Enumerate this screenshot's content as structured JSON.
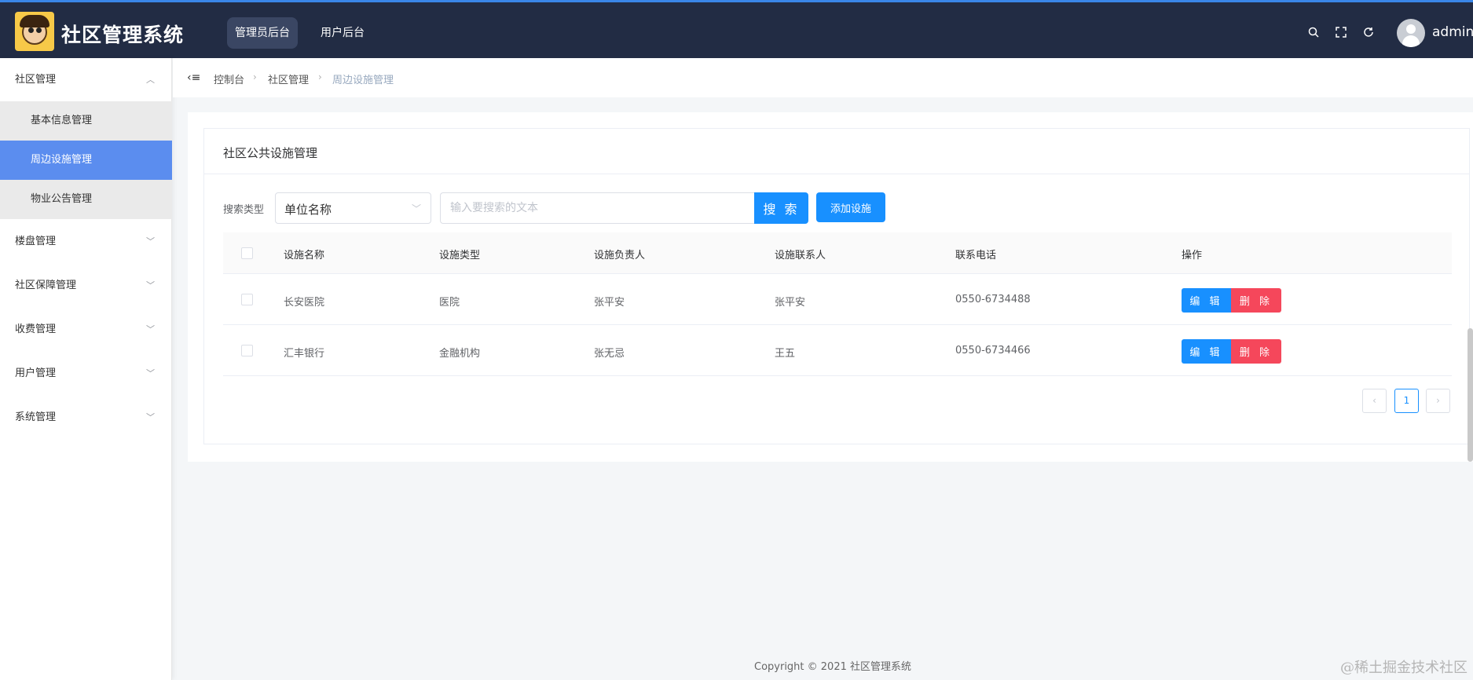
{
  "header": {
    "app_title": "社区管理系统",
    "tabs": [
      {
        "label": "管理员后台",
        "active": true
      },
      {
        "label": "用户后台",
        "active": false
      }
    ],
    "icons": [
      "search-icon",
      "fullscreen-icon",
      "refresh-icon"
    ],
    "username": "admin",
    "background_color": "#222c44"
  },
  "sidebar": {
    "groups": [
      {
        "label": "社区管理",
        "expanded": true,
        "children": [
          {
            "label": "基本信息管理",
            "active": false
          },
          {
            "label": "周边设施管理",
            "active": true
          },
          {
            "label": "物业公告管理",
            "active": false
          }
        ]
      },
      {
        "label": "楼盘管理",
        "expanded": false
      },
      {
        "label": "社区保障管理",
        "expanded": false
      },
      {
        "label": "收费管理",
        "expanded": false
      },
      {
        "label": "用户管理",
        "expanded": false
      },
      {
        "label": "系统管理",
        "expanded": false
      }
    ],
    "active_color": "#5b8def"
  },
  "breadcrumb": [
    "控制台",
    "社区管理",
    "周边设施管理"
  ],
  "card": {
    "title": "社区公共设施管理"
  },
  "search": {
    "type_label": "搜索类型",
    "type_selected": "单位名称",
    "placeholder": "输入要搜索的文本",
    "value": "",
    "button_label": "搜 索",
    "add_button_label": "添加设施"
  },
  "table": {
    "columns": [
      "设施名称",
      "设施类型",
      "设施负责人",
      "设施联系人",
      "联系电话",
      "操作"
    ],
    "rows": [
      {
        "name": "长安医院",
        "type": "医院",
        "manager": "张平安",
        "contact": "张平安",
        "phone": "0550-6734488"
      },
      {
        "name": "汇丰银行",
        "type": "金融机构",
        "manager": "张无忌",
        "contact": "王五",
        "phone": "0550-6734466"
      }
    ],
    "edit_label": "编 辑",
    "delete_label": "删 除"
  },
  "pagination": {
    "current_page": "1",
    "prev": "‹",
    "next": "›"
  },
  "footer": "Copyright © 2021 社区管理系统",
  "watermark": "@稀土掘金技术社区",
  "colors": {
    "primary": "#1890ff",
    "danger": "#f5475b"
  }
}
